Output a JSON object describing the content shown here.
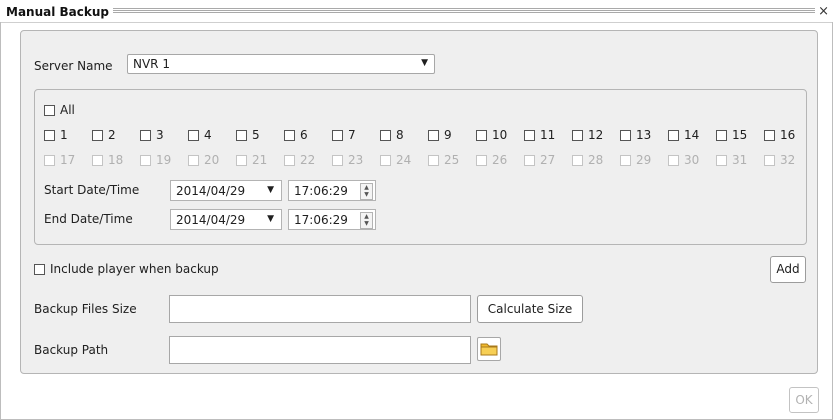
{
  "window": {
    "title": "Manual Backup",
    "close_glyph": "×"
  },
  "server": {
    "label": "Server Name",
    "selected": "NVR 1"
  },
  "channels": {
    "all_label": "All",
    "enabled": [
      "1",
      "2",
      "3",
      "4",
      "5",
      "6",
      "7",
      "8",
      "9",
      "10",
      "11",
      "12",
      "13",
      "14",
      "15",
      "16"
    ],
    "disabled": [
      "17",
      "18",
      "19",
      "20",
      "21",
      "22",
      "23",
      "24",
      "25",
      "26",
      "27",
      "28",
      "29",
      "30",
      "31",
      "32"
    ]
  },
  "start": {
    "label": "Start Date/Time",
    "date": "2014/04/29",
    "time": "17:06:29"
  },
  "end": {
    "label": "End Date/Time",
    "date": "2014/04/29",
    "time": "17:06:29"
  },
  "include_player": {
    "label": "Include player when backup",
    "checked": false
  },
  "buttons": {
    "add": "Add",
    "calculate": "Calculate Size",
    "ok": "OK"
  },
  "backup_size": {
    "label": "Backup Files Size",
    "value": ""
  },
  "backup_path": {
    "label": "Backup Path",
    "value": ""
  },
  "icons": {
    "dropdown": "caret-down-icon",
    "spin": "spin-arrows-icon",
    "folder": "folder-icon",
    "close": "close-icon"
  },
  "colors": {
    "panel": "#efefef",
    "folder": "#f0b92c"
  }
}
